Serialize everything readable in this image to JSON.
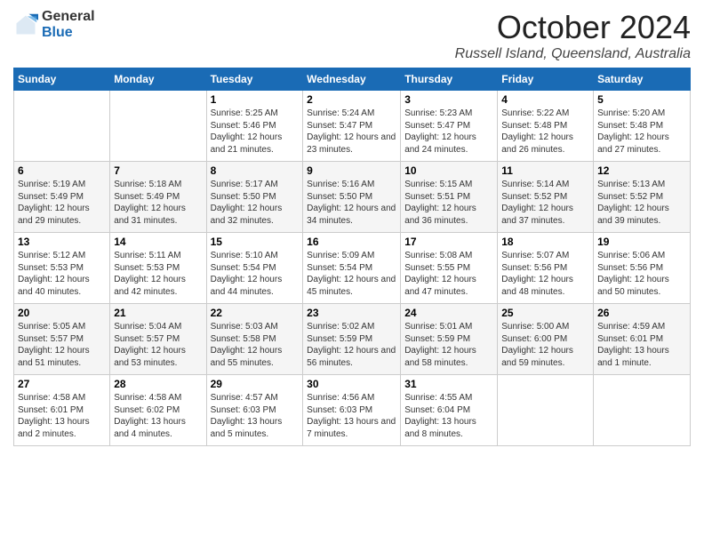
{
  "header": {
    "logo_general": "General",
    "logo_blue": "Blue",
    "month": "October 2024",
    "location": "Russell Island, Queensland, Australia"
  },
  "days_of_week": [
    "Sunday",
    "Monday",
    "Tuesday",
    "Wednesday",
    "Thursday",
    "Friday",
    "Saturday"
  ],
  "weeks": [
    [
      {
        "day": "",
        "details": ""
      },
      {
        "day": "",
        "details": ""
      },
      {
        "day": "1",
        "details": "Sunrise: 5:25 AM\nSunset: 5:46 PM\nDaylight: 12 hours and 21 minutes."
      },
      {
        "day": "2",
        "details": "Sunrise: 5:24 AM\nSunset: 5:47 PM\nDaylight: 12 hours and 23 minutes."
      },
      {
        "day": "3",
        "details": "Sunrise: 5:23 AM\nSunset: 5:47 PM\nDaylight: 12 hours and 24 minutes."
      },
      {
        "day": "4",
        "details": "Sunrise: 5:22 AM\nSunset: 5:48 PM\nDaylight: 12 hours and 26 minutes."
      },
      {
        "day": "5",
        "details": "Sunrise: 5:20 AM\nSunset: 5:48 PM\nDaylight: 12 hours and 27 minutes."
      }
    ],
    [
      {
        "day": "6",
        "details": "Sunrise: 5:19 AM\nSunset: 5:49 PM\nDaylight: 12 hours and 29 minutes."
      },
      {
        "day": "7",
        "details": "Sunrise: 5:18 AM\nSunset: 5:49 PM\nDaylight: 12 hours and 31 minutes."
      },
      {
        "day": "8",
        "details": "Sunrise: 5:17 AM\nSunset: 5:50 PM\nDaylight: 12 hours and 32 minutes."
      },
      {
        "day": "9",
        "details": "Sunrise: 5:16 AM\nSunset: 5:50 PM\nDaylight: 12 hours and 34 minutes."
      },
      {
        "day": "10",
        "details": "Sunrise: 5:15 AM\nSunset: 5:51 PM\nDaylight: 12 hours and 36 minutes."
      },
      {
        "day": "11",
        "details": "Sunrise: 5:14 AM\nSunset: 5:52 PM\nDaylight: 12 hours and 37 minutes."
      },
      {
        "day": "12",
        "details": "Sunrise: 5:13 AM\nSunset: 5:52 PM\nDaylight: 12 hours and 39 minutes."
      }
    ],
    [
      {
        "day": "13",
        "details": "Sunrise: 5:12 AM\nSunset: 5:53 PM\nDaylight: 12 hours and 40 minutes."
      },
      {
        "day": "14",
        "details": "Sunrise: 5:11 AM\nSunset: 5:53 PM\nDaylight: 12 hours and 42 minutes."
      },
      {
        "day": "15",
        "details": "Sunrise: 5:10 AM\nSunset: 5:54 PM\nDaylight: 12 hours and 44 minutes."
      },
      {
        "day": "16",
        "details": "Sunrise: 5:09 AM\nSunset: 5:54 PM\nDaylight: 12 hours and 45 minutes."
      },
      {
        "day": "17",
        "details": "Sunrise: 5:08 AM\nSunset: 5:55 PM\nDaylight: 12 hours and 47 minutes."
      },
      {
        "day": "18",
        "details": "Sunrise: 5:07 AM\nSunset: 5:56 PM\nDaylight: 12 hours and 48 minutes."
      },
      {
        "day": "19",
        "details": "Sunrise: 5:06 AM\nSunset: 5:56 PM\nDaylight: 12 hours and 50 minutes."
      }
    ],
    [
      {
        "day": "20",
        "details": "Sunrise: 5:05 AM\nSunset: 5:57 PM\nDaylight: 12 hours and 51 minutes."
      },
      {
        "day": "21",
        "details": "Sunrise: 5:04 AM\nSunset: 5:57 PM\nDaylight: 12 hours and 53 minutes."
      },
      {
        "day": "22",
        "details": "Sunrise: 5:03 AM\nSunset: 5:58 PM\nDaylight: 12 hours and 55 minutes."
      },
      {
        "day": "23",
        "details": "Sunrise: 5:02 AM\nSunset: 5:59 PM\nDaylight: 12 hours and 56 minutes."
      },
      {
        "day": "24",
        "details": "Sunrise: 5:01 AM\nSunset: 5:59 PM\nDaylight: 12 hours and 58 minutes."
      },
      {
        "day": "25",
        "details": "Sunrise: 5:00 AM\nSunset: 6:00 PM\nDaylight: 12 hours and 59 minutes."
      },
      {
        "day": "26",
        "details": "Sunrise: 4:59 AM\nSunset: 6:01 PM\nDaylight: 13 hours and 1 minute."
      }
    ],
    [
      {
        "day": "27",
        "details": "Sunrise: 4:58 AM\nSunset: 6:01 PM\nDaylight: 13 hours and 2 minutes."
      },
      {
        "day": "28",
        "details": "Sunrise: 4:58 AM\nSunset: 6:02 PM\nDaylight: 13 hours and 4 minutes."
      },
      {
        "day": "29",
        "details": "Sunrise: 4:57 AM\nSunset: 6:03 PM\nDaylight: 13 hours and 5 minutes."
      },
      {
        "day": "30",
        "details": "Sunrise: 4:56 AM\nSunset: 6:03 PM\nDaylight: 13 hours and 7 minutes."
      },
      {
        "day": "31",
        "details": "Sunrise: 4:55 AM\nSunset: 6:04 PM\nDaylight: 13 hours and 8 minutes."
      },
      {
        "day": "",
        "details": ""
      },
      {
        "day": "",
        "details": ""
      }
    ]
  ]
}
